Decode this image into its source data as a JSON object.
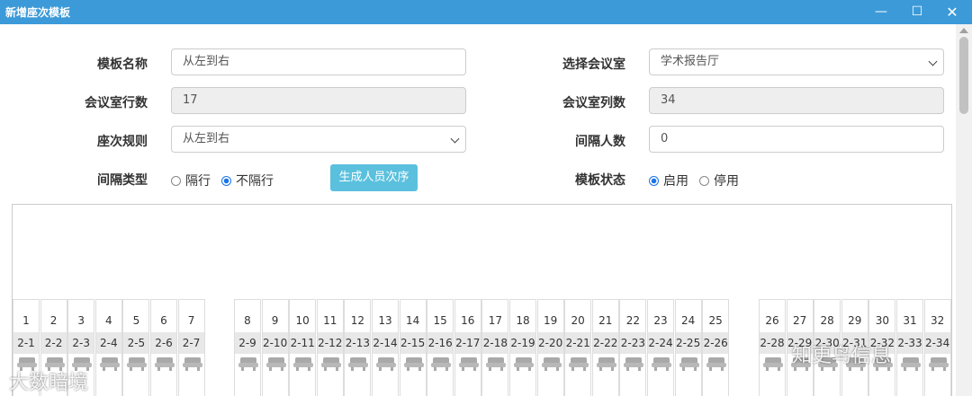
{
  "window": {
    "title": "新增座次模板"
  },
  "form": {
    "template_name": {
      "label": "模板名称",
      "value": "从左到右"
    },
    "room_select": {
      "label": "选择会议室",
      "value": "学术报告厅"
    },
    "rows": {
      "label": "会议室行数",
      "value": "17"
    },
    "cols": {
      "label": "会议室列数",
      "value": "34"
    },
    "seat_rule": {
      "label": "座次规则",
      "value": "从左到右"
    },
    "interval_count": {
      "label": "间隔人数",
      "value": "0"
    },
    "interval_type": {
      "label": "间隔类型",
      "options": [
        "隔行",
        "不隔行"
      ],
      "selected": "不隔行"
    },
    "generate_button": "生成人员次序",
    "template_status": {
      "label": "模板状态",
      "options": [
        "启用",
        "停用"
      ],
      "selected": "启用"
    }
  },
  "seats": [
    {
      "num": "1",
      "tag": "2-1"
    },
    {
      "num": "2",
      "tag": "2-2"
    },
    {
      "num": "3",
      "tag": "2-3"
    },
    {
      "num": "4",
      "tag": "2-4"
    },
    {
      "num": "5",
      "tag": "2-5"
    },
    {
      "num": "6",
      "tag": "2-6"
    },
    {
      "num": "7",
      "tag": "2-7"
    },
    {
      "num": "8",
      "tag": "2-9"
    },
    {
      "num": "9",
      "tag": "2-10"
    },
    {
      "num": "10",
      "tag": "2-11"
    },
    {
      "num": "11",
      "tag": "2-12"
    },
    {
      "num": "12",
      "tag": "2-13"
    },
    {
      "num": "13",
      "tag": "2-14"
    },
    {
      "num": "14",
      "tag": "2-15"
    },
    {
      "num": "15",
      "tag": "2-16"
    },
    {
      "num": "16",
      "tag": "2-17"
    },
    {
      "num": "17",
      "tag": "2-18"
    },
    {
      "num": "18",
      "tag": "2-19"
    },
    {
      "num": "19",
      "tag": "2-20"
    },
    {
      "num": "20",
      "tag": "2-21"
    },
    {
      "num": "21",
      "tag": "2-22"
    },
    {
      "num": "22",
      "tag": "2-23"
    },
    {
      "num": "23",
      "tag": "2-24"
    },
    {
      "num": "24",
      "tag": "2-25"
    },
    {
      "num": "25",
      "tag": "2-26"
    },
    {
      "num": "26",
      "tag": "2-28"
    },
    {
      "num": "27",
      "tag": "2-29"
    },
    {
      "num": "28",
      "tag": "2-30"
    },
    {
      "num": "29",
      "tag": "2-31"
    },
    {
      "num": "30",
      "tag": "2-32"
    },
    {
      "num": "31",
      "tag": "2-33"
    },
    {
      "num": "32",
      "tag": "2-34"
    }
  ],
  "watermarks": {
    "left": "大数暗境",
    "right": "知更鸟信息"
  }
}
